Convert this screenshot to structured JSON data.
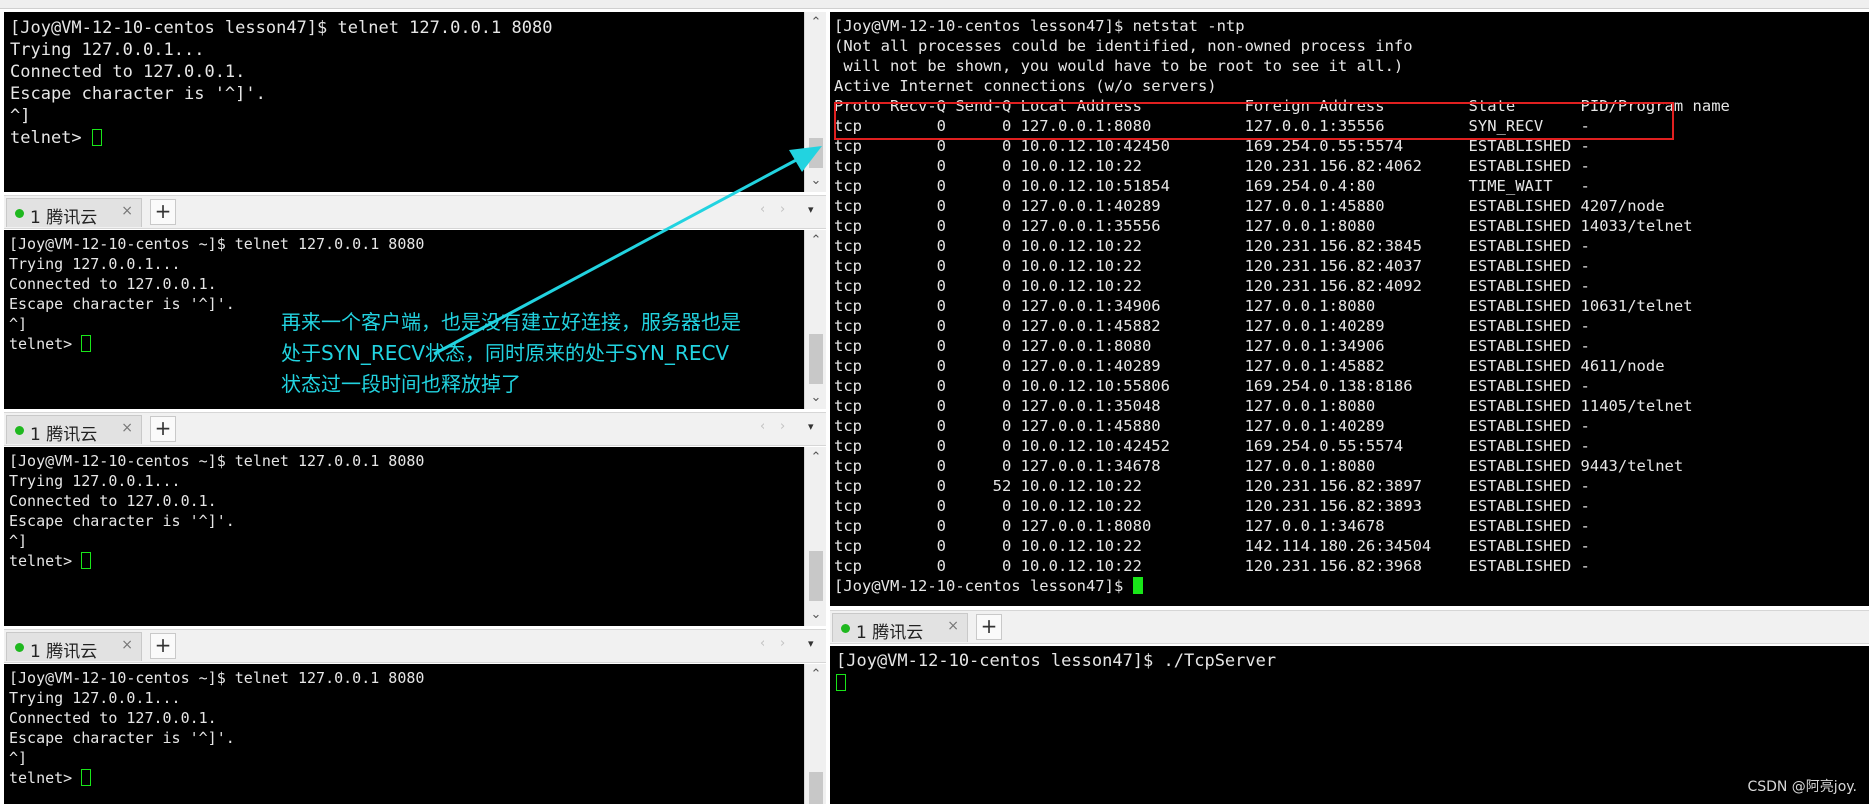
{
  "tab_name": "1 腾讯云",
  "tab_close": "×",
  "tab_add": "+",
  "nav_prev": "‹",
  "nav_next": "›",
  "menu_arrow": "▾",
  "scroll_up": "⌃",
  "scroll_down": "⌄",
  "colors": {
    "terminal_bg": "#000000",
    "cursor": "#19e619",
    "highlight": "#e02020",
    "annotation": "#22d3e0"
  },
  "client1": {
    "lines": [
      "[Joy@VM-12-10-centos lesson47]$ telnet 127.0.0.1 8080",
      "Trying 127.0.0.1...",
      "Connected to 127.0.0.1.",
      "Escape character is '^]'.",
      "^]"
    ],
    "prompt": "telnet> "
  },
  "client2": {
    "lines": [
      "[Joy@VM-12-10-centos ~]$ telnet 127.0.0.1 8080",
      "Trying 127.0.0.1...",
      "Connected to 127.0.0.1.",
      "Escape character is '^]'.",
      "^]"
    ],
    "prompt": "telnet> "
  },
  "client3": {
    "lines": [
      "[Joy@VM-12-10-centos ~]$ telnet 127.0.0.1 8080",
      "Trying 127.0.0.1...",
      "Connected to 127.0.0.1.",
      "Escape character is '^]'.",
      "^]"
    ],
    "prompt": "telnet> "
  },
  "client4": {
    "lines": [
      "[Joy@VM-12-10-centos ~]$ telnet 127.0.0.1 8080",
      "Trying 127.0.0.1...",
      "Connected to 127.0.0.1.",
      "Escape character is '^]'.",
      "^]"
    ],
    "prompt": "telnet> "
  },
  "netstat": {
    "header_lines": [
      "[Joy@VM-12-10-centos lesson47]$ netstat -ntp",
      "(Not all processes could be identified, non-owned process info",
      " will not be shown, you would have to be root to see it all.)",
      "Active Internet connections (w/o servers)",
      "Proto Recv-Q Send-Q Local Address           Foreign Address         State       PID/Program name"
    ],
    "rows": [
      "tcp        0      0 127.0.0.1:8080          127.0.0.1:35556         SYN_RECV    -",
      "tcp        0      0 10.0.12.10:42450        169.254.0.55:5574       ESTABLISHED -",
      "tcp        0      0 10.0.12.10:22           120.231.156.82:4062     ESTABLISHED -",
      "tcp        0      0 10.0.12.10:51854        169.254.0.4:80          TIME_WAIT   -",
      "tcp        0      0 127.0.0.1:40289         127.0.0.1:45880         ESTABLISHED 4207/node",
      "tcp        0      0 127.0.0.1:35556         127.0.0.1:8080          ESTABLISHED 14033/telnet",
      "tcp        0      0 10.0.12.10:22           120.231.156.82:3845     ESTABLISHED -",
      "tcp        0      0 10.0.12.10:22           120.231.156.82:4037     ESTABLISHED -",
      "tcp        0      0 10.0.12.10:22           120.231.156.82:4092     ESTABLISHED -",
      "tcp        0      0 127.0.0.1:34906         127.0.0.1:8080          ESTABLISHED 10631/telnet",
      "tcp        0      0 127.0.0.1:45882         127.0.0.1:40289         ESTABLISHED -",
      "tcp        0      0 127.0.0.1:8080          127.0.0.1:34906         ESTABLISHED -",
      "tcp        0      0 127.0.0.1:40289         127.0.0.1:45882         ESTABLISHED 4611/node",
      "tcp        0      0 10.0.12.10:55806        169.254.0.138:8186      ESTABLISHED -",
      "tcp        0      0 127.0.0.1:35048         127.0.0.1:8080          ESTABLISHED 11405/telnet",
      "tcp        0      0 127.0.0.1:45880         127.0.0.1:40289         ESTABLISHED -",
      "tcp        0      0 10.0.12.10:42452        169.254.0.55:5574       ESTABLISHED -",
      "tcp        0      0 127.0.0.1:34678         127.0.0.1:8080          ESTABLISHED 9443/telnet",
      "tcp        0     52 10.0.12.10:22           120.231.156.82:3897     ESTABLISHED -",
      "tcp        0      0 10.0.12.10:22           120.231.156.82:3893     ESTABLISHED -",
      "tcp        0      0 127.0.0.1:8080          127.0.0.1:34678         ESTABLISHED -",
      "tcp        0      0 10.0.12.10:22           142.114.180.26:34504    ESTABLISHED -",
      "tcp        0      0 10.0.12.10:22           120.231.156.82:3968     ESTABLISHED -"
    ],
    "prompt": "[Joy@VM-12-10-centos lesson47]$ "
  },
  "server": {
    "command": "[Joy@VM-12-10-centos lesson47]$ ./TcpServer"
  },
  "annotation": {
    "line1": "再来一个客户端，也是没有建立好连接，服务器也是",
    "line2": "处于SYN_RECV状态，同时原来的处于SYN_RECV",
    "line3": "状态过一段时间也释放掉了"
  },
  "watermark": "CSDN @阿亮joy."
}
